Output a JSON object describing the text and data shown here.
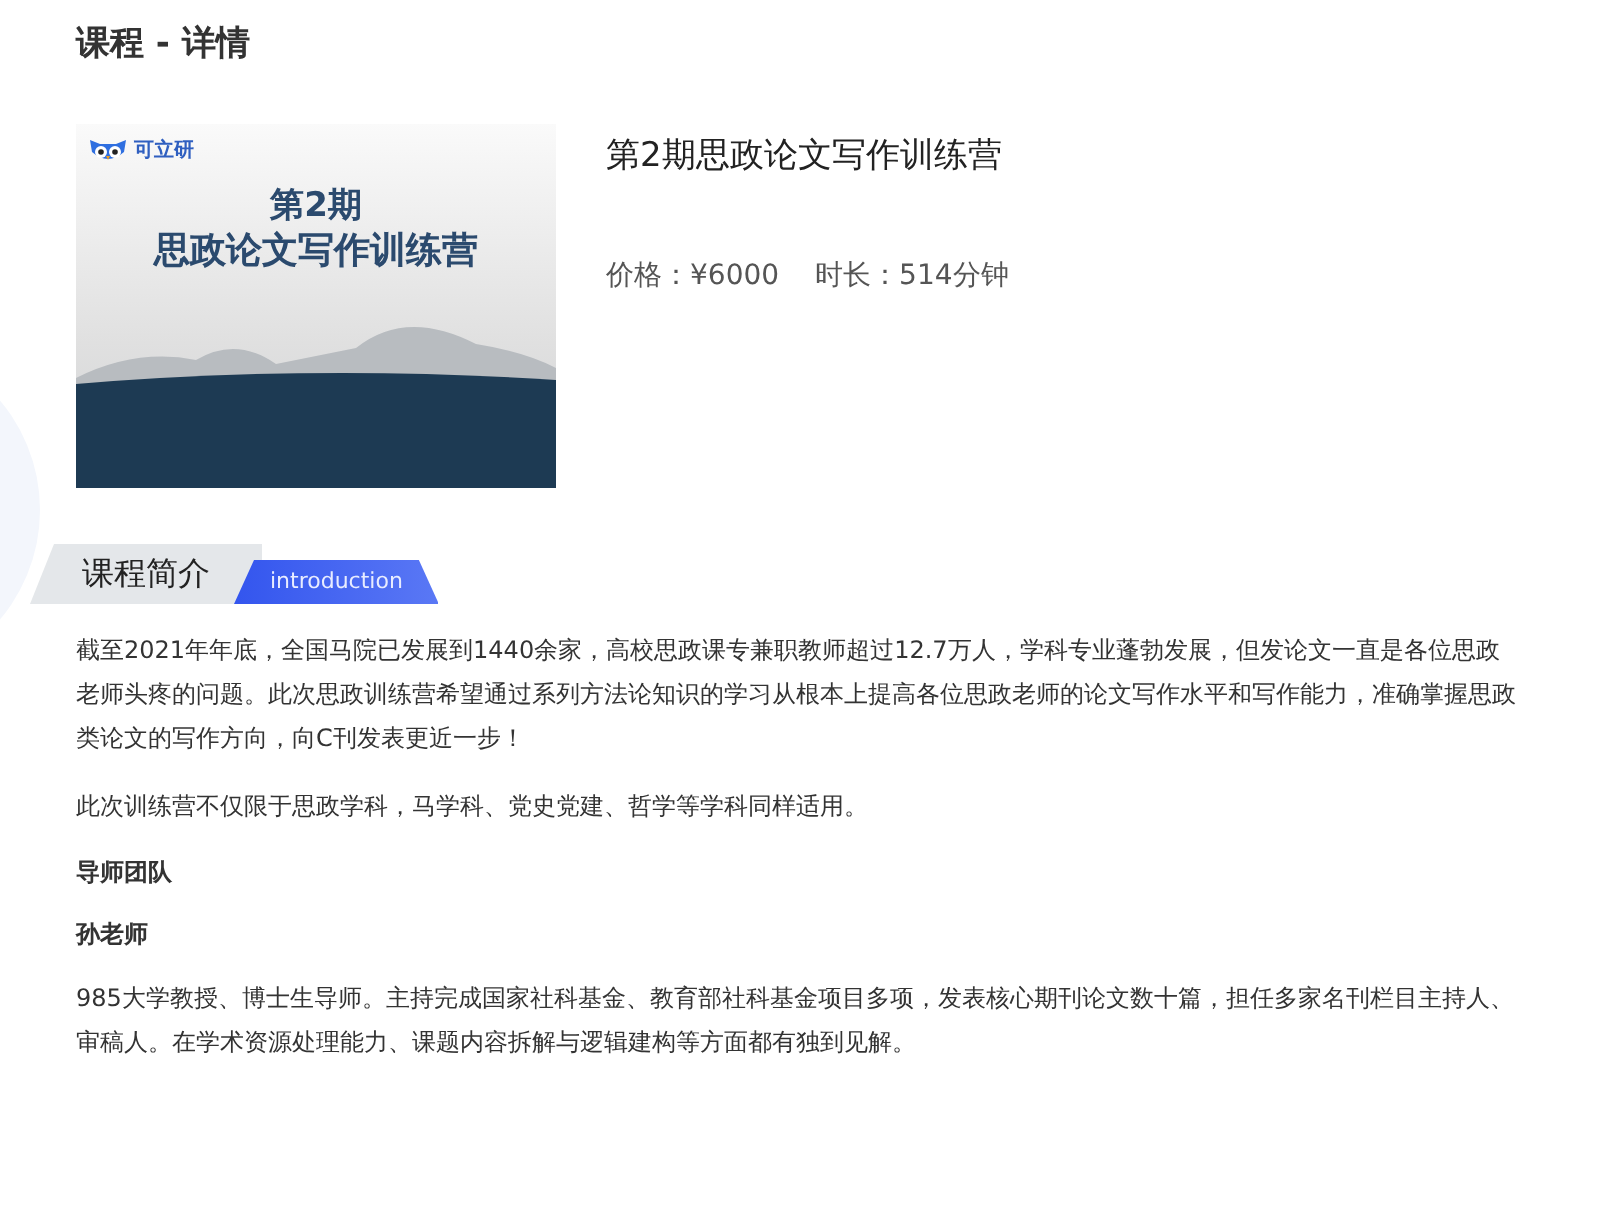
{
  "page_title": "课程 - 详情",
  "course": {
    "cover": {
      "logo": "可立研",
      "lines": [
        "第2期",
        "思政论文写作训练营"
      ]
    },
    "title": "第2期思政论文写作训练营",
    "price_label": "价格：",
    "price": "¥6000",
    "duration_label": "时长：",
    "duration": "514分钟"
  },
  "intro_section": {
    "heading": "课程简介",
    "subheading": "introduction",
    "paragraphs": [
      "截至2021年年底，全国马院已发展到1440余家，高校思政课专兼职教师超过12.7万人，学科专业蓬勃发展，但发论文一直是各位思政老师头疼的问题。此次思政训练营希望通过系列方法论知识的学习从根本上提高各位思政老师的论文写作水平和写作能力，准确掌握思政类论文的写作方向，向C刊发表更近一步！",
      "此次训练营不仅限于思政学科，马学科、党史党建、哲学等学科同样适用。"
    ]
  },
  "team": {
    "heading": "导师团队",
    "teachers": [
      {
        "name": "孙老师",
        "bio": "985大学教授、博士生导师。主持完成国家社科基金、教育部社科基金项目多项，发表核心期刊论文数十篇，担任多家名刊栏目主持人、审稿人。在学术资源处理能力、课题内容拆解与逻辑建构等方面都有独到见解。"
      }
    ]
  }
}
